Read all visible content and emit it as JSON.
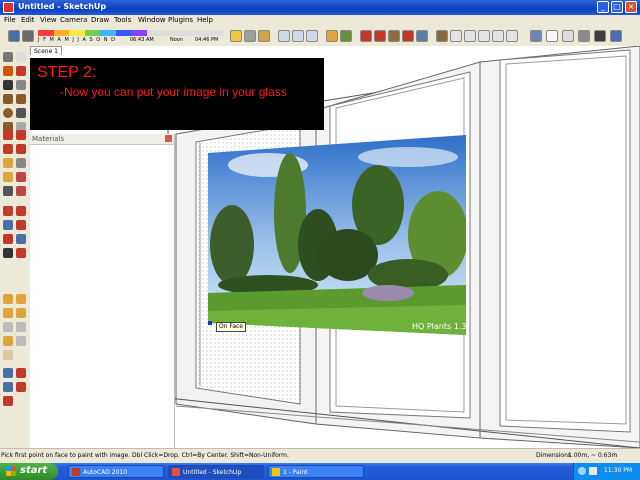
{
  "window": {
    "title": "Untitled - SketchUp"
  },
  "menu": [
    "File",
    "Edit",
    "View",
    "Camera",
    "Draw",
    "Tools",
    "Window",
    "Plugins",
    "Help"
  ],
  "shadows": {
    "months": "J F M A M J J A S O N D",
    "time_start": "06:43 AM",
    "time_mid": "Noon",
    "time_end": "04:46 PM"
  },
  "scene_tab": "Scene 1",
  "materials_panel": {
    "title": "Materials"
  },
  "overlay": {
    "heading": "STEP 2:",
    "line": "-Now you can put your image in your glass"
  },
  "image_watermark": "HQ Plants 1.3",
  "tooltip": "On Face",
  "status": {
    "hint": "Pick first point on face to paint with image. Dbl Click=Drop. Ctrl=By Center. Shift=Non-Uniform.",
    "dimensions_label": "Dimensions",
    "dimensions_value": "1.00m, ~ 0.63m"
  },
  "taskbar": {
    "start": "start",
    "items": [
      "AutoCAD 2010",
      "Untitled - SketchUp",
      "1 - Paint"
    ],
    "clock": "11:30 PM"
  },
  "colors": {
    "title_blue": "#0a3fbf",
    "start_green": "#2f8b2a",
    "overlay_red": "#ff1a1a"
  }
}
